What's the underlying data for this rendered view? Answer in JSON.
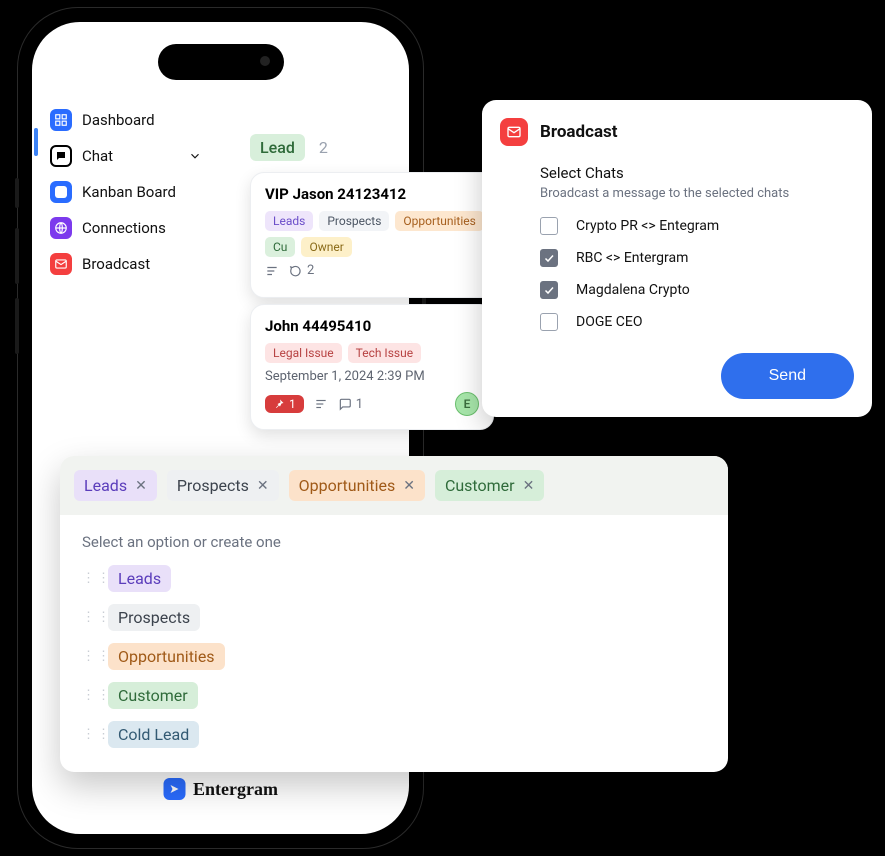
{
  "brand": {
    "name": "Entergram"
  },
  "sidebar": {
    "items": [
      {
        "label": "Dashboard",
        "icon": "dashboard-icon",
        "color": "ic-dashboard"
      },
      {
        "label": "Chat",
        "icon": "chat-icon",
        "color": "ic-chat",
        "has_children": true
      },
      {
        "label": "Kanban Board",
        "icon": "kanban-icon",
        "color": "ic-kanban",
        "active": true
      },
      {
        "label": "Connections",
        "icon": "globe-icon",
        "color": "ic-conn"
      },
      {
        "label": "Broadcast",
        "icon": "mail-icon",
        "color": "ic-broadcast"
      }
    ]
  },
  "column": {
    "name": "Lead",
    "count": "2"
  },
  "cards": {
    "c1": {
      "title": "VIP Jason 24123412",
      "tags": [
        "Leads",
        "Prospects",
        "Opportunities",
        "Cu",
        "Owner"
      ],
      "comments": "2"
    },
    "c2": {
      "title": "John 44495410",
      "tags": [
        "Legal Issue",
        "Tech Issue"
      ],
      "datetime": "September 1, 2024 2:39 PM",
      "pin_count": "1",
      "comment_count": "1",
      "avatar_initial": "E"
    }
  },
  "broadcast": {
    "title": "Broadcast",
    "subtitle": "Select Chats",
    "hint": "Broadcast a message to the selected chats",
    "send_label": "Send",
    "chats": [
      {
        "label": "Crypto PR <> Entegram",
        "checked": false
      },
      {
        "label": "RBC <> Entergram",
        "checked": true
      },
      {
        "label": "Magdalena Crypto",
        "checked": true
      },
      {
        "label": "DOGE CEO",
        "checked": false
      }
    ]
  },
  "picker": {
    "selected": [
      {
        "label": "Leads",
        "cls": "c-leads"
      },
      {
        "label": "Prospects",
        "cls": "c-pros"
      },
      {
        "label": "Opportunities",
        "cls": "c-opps"
      },
      {
        "label": "Customer",
        "cls": "c-cust"
      }
    ],
    "hint": "Select an option or create one",
    "options": [
      {
        "label": "Leads",
        "cls": "c-leads"
      },
      {
        "label": "Prospects",
        "cls": "c-pros"
      },
      {
        "label": "Opportunities",
        "cls": "c-opps"
      },
      {
        "label": "Customer",
        "cls": "c-cust"
      },
      {
        "label": "Cold Lead",
        "cls": "c-cold"
      }
    ]
  }
}
